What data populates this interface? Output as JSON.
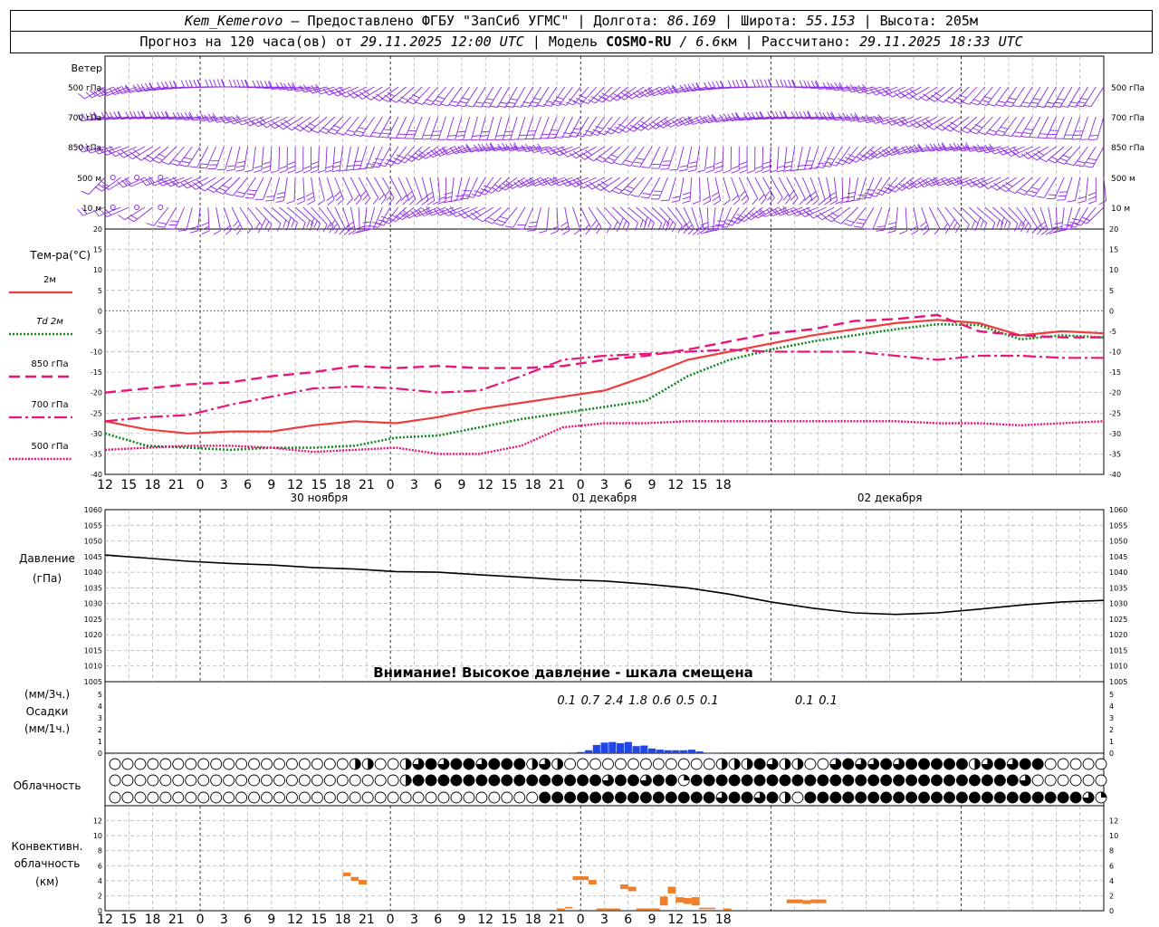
{
  "header": {
    "station": "Kem_Kemerovo",
    "provider": "— Предоставлено ФГБУ \"ЗапСиб УГМС\"",
    "lon_label": "Долгота:",
    "lon": "86.169",
    "lat_label": "Широта:",
    "lat": "55.153",
    "alt_label": "Высота:",
    "alt": "205",
    "alt_unit": "м",
    "forecast_label": "Прогноз на 120 часа(ов) от",
    "run": "29.11.2025 12:00 UTC",
    "model_label": "Модель",
    "model": "COSMO-RU",
    "res": "/ 6.6",
    "res_unit": "км",
    "calc_label": "Рассчитано:",
    "calc": "29.11.2025 18:33 UTC",
    "sep": "|"
  },
  "colors": {
    "t2m": "#f03c3c",
    "td2m": "#11881f",
    "t850": "#e8157a",
    "t700": "#e8157a",
    "t500": "#e8157a",
    "wind": "#8a2be2",
    "pressure": "#000000",
    "precip": "#2046e8",
    "conv": "#f07f2a",
    "zero": "#3355dd"
  },
  "chart_data": [
    {
      "type": "wind-barbs",
      "title": "Ветер",
      "levels": [
        "500 гПа",
        "700 гПа",
        "850 гПа",
        "500 м",
        "10 м"
      ],
      "time_step_h": 1
    },
    {
      "type": "line",
      "ylabel": "Тем-ра(°С)",
      "ylim": [
        -40,
        20
      ],
      "yticks": [
        20,
        15,
        10,
        5,
        0,
        -5,
        -10,
        -15,
        -20,
        -25,
        -30,
        -35,
        -40
      ],
      "x_hours": [
        0,
        6,
        12,
        18,
        24,
        30,
        36,
        42,
        48,
        54,
        60,
        66,
        72,
        78,
        84,
        90,
        96,
        102,
        108,
        114,
        120,
        126
      ],
      "series": [
        {
          "name": "2м",
          "style": "solid",
          "values": [
            -27,
            -29,
            -30,
            -29.5,
            -29.5,
            -28,
            -27,
            -27.5,
            -26,
            -24,
            -22.5,
            -21,
            -19.5,
            -16,
            -12,
            -10,
            -8,
            -6,
            -4.5,
            -3,
            -2.2,
            -3,
            -6,
            -5,
            -5.5
          ]
        },
        {
          "name": "Td 2м",
          "style": "dotted",
          "values": [
            -30,
            -33,
            -33.5,
            -34,
            -33.5,
            -33.5,
            -33,
            -31,
            -30.5,
            -28.5,
            -26.5,
            -25,
            -23.5,
            -22,
            -16,
            -12,
            -9.5,
            -7.5,
            -6,
            -4.5,
            -3.3,
            -3.5,
            -7,
            -6,
            -6.5
          ]
        },
        {
          "name": "850 гПа",
          "style": "dash",
          "values": [
            -20,
            -19,
            -18,
            -17.5,
            -16,
            -15,
            -13.5,
            -14,
            -13.5,
            -14,
            -14,
            -13.5,
            -12,
            -11,
            -9.5,
            -7.5,
            -5.5,
            -4.5,
            -2.5,
            -2,
            -1,
            -5,
            -6,
            -6.5,
            -6.5
          ]
        },
        {
          "name": "700 гПа",
          "style": "dashdot",
          "values": [
            -27,
            -26,
            -25.5,
            -23,
            -21,
            -19,
            -18.5,
            -19,
            -20,
            -19.5,
            -16,
            -12,
            -11,
            -10.5,
            -10,
            -9.5,
            -10,
            -10,
            -10,
            -11,
            -12,
            -11,
            -11,
            -11.5,
            -11.5
          ]
        },
        {
          "name": "500 гПа",
          "style": "dotted",
          "values": [
            -34,
            -33.5,
            -33,
            -33,
            -33.5,
            -34.5,
            -34,
            -33.5,
            -35,
            -35,
            -33,
            -28.5,
            -27.5,
            -27.5,
            -27,
            -27,
            -27,
            -27,
            -27,
            -27,
            -27.5,
            -27.5,
            -28,
            -27.5,
            -27
          ]
        }
      ],
      "x_ticks": [
        "12",
        "15",
        "18",
        "21",
        "0",
        "3",
        "6",
        "9",
        "12",
        "15",
        "18",
        "21",
        "0",
        "3",
        "6",
        "9",
        "12",
        "15",
        "18",
        "21",
        "0",
        "3",
        "6",
        "9",
        "12",
        "15",
        "18"
      ],
      "dates": [
        "30 ноября",
        "01 декабря",
        "02 декабря"
      ]
    },
    {
      "type": "line",
      "ylabel": "Давление",
      "yunit": "(гПа)",
      "ylim": [
        1005,
        1060
      ],
      "yticks": [
        1060,
        1055,
        1050,
        1045,
        1040,
        1035,
        1030,
        1025,
        1020,
        1015,
        1010,
        1005
      ],
      "values": [
        1045.5,
        1044.5,
        1043.5,
        1042.8,
        1042.3,
        1041.5,
        1041,
        1040.2,
        1040,
        1039.2,
        1038.4,
        1037.6,
        1037.2,
        1036.2,
        1035,
        1033,
        1030.5,
        1028.5,
        1027,
        1026.5,
        1027,
        1028.2,
        1029.5,
        1030.5,
        1031
      ],
      "annotation": "Внимание! Высокое давление - шкала смещена"
    },
    {
      "type": "bar",
      "ylabel_top": "(мм/3ч.)",
      "ylabel": "Осадки",
      "yunit": "(мм/1ч.)",
      "ylim": [
        0,
        5
      ],
      "yticks": [
        5,
        4,
        3,
        2,
        1,
        0
      ],
      "bars": [
        {
          "h": 57,
          "v": 0.05
        },
        {
          "h": 58,
          "v": 0.05
        },
        {
          "h": 60,
          "v": 0.1
        },
        {
          "h": 61,
          "v": 0.25
        },
        {
          "h": 62,
          "v": 0.7
        },
        {
          "h": 63,
          "v": 0.9
        },
        {
          "h": 64,
          "v": 0.95
        },
        {
          "h": 65,
          "v": 0.85
        },
        {
          "h": 66,
          "v": 0.95
        },
        {
          "h": 67,
          "v": 0.6
        },
        {
          "h": 68,
          "v": 0.65
        },
        {
          "h": 69,
          "v": 0.4
        },
        {
          "h": 70,
          "v": 0.3
        },
        {
          "h": 71,
          "v": 0.25
        },
        {
          "h": 72,
          "v": 0.25
        },
        {
          "h": 73,
          "v": 0.25
        },
        {
          "h": 74,
          "v": 0.3
        },
        {
          "h": 75,
          "v": 0.15
        },
        {
          "h": 76,
          "v": 0.05
        },
        {
          "h": 77,
          "v": 0.05
        },
        {
          "h": 88,
          "v": 0.05
        },
        {
          "h": 89,
          "v": 0.05
        },
        {
          "h": 92,
          "v": 0.05
        },
        {
          "h": 93,
          "v": 0.05
        }
      ],
      "labels_3h": [
        {
          "h": 58,
          "text": "0.1"
        },
        {
          "h": 61,
          "text": "0.7"
        },
        {
          "h": 64,
          "text": "2.4"
        },
        {
          "h": 67,
          "text": "1.8"
        },
        {
          "h": 70,
          "text": "0.6"
        },
        {
          "h": 73,
          "text": "0.5"
        },
        {
          "h": 76,
          "text": "0.1"
        },
        {
          "h": 88,
          "text": "0.1"
        },
        {
          "h": 91,
          "text": "0.1"
        }
      ]
    },
    {
      "type": "cloud-symbols",
      "ylabel": "Облачность",
      "rows": [
        "0000000000000000000220023434434442320000000000002224322003433434444423434400000000000000000000000004004243200",
        "0000000000000000000000024444444444444443443441444444444444444444444444443000000000000000000000000002314210000",
        "0000000000000000000000000000000000444444444444443443420444444444444444444444431000000000000000000044444444444"
      ]
    },
    {
      "type": "bar",
      "ylabel": "Конвективн.",
      "ylabel2": "облачность",
      "yunit": "(км)",
      "ylim": [
        0,
        14
      ],
      "yticks": [
        12,
        10,
        8,
        6,
        4,
        2,
        0
      ],
      "segments": [
        {
          "h0": 30,
          "h1": 31,
          "base": 4.6,
          "top": 5.1
        },
        {
          "h0": 31,
          "h1": 32,
          "base": 4.0,
          "top": 4.5
        },
        {
          "h0": 32,
          "h1": 33,
          "base": 3.5,
          "top": 4.1
        },
        {
          "h0": 57,
          "h1": 58,
          "base": 0.1,
          "top": 0.3
        },
        {
          "h0": 58,
          "h1": 59,
          "base": 0.3,
          "top": 0.5
        },
        {
          "h0": 59,
          "h1": 60,
          "base": 4.1,
          "top": 4.6
        },
        {
          "h0": 60,
          "h1": 61,
          "base": 4.1,
          "top": 4.6
        },
        {
          "h0": 61,
          "h1": 62,
          "base": 3.5,
          "top": 4.1
        },
        {
          "h0": 62,
          "h1": 65,
          "base": 0.1,
          "top": 0.3
        },
        {
          "h0": 65,
          "h1": 66,
          "base": 2.9,
          "top": 3.5
        },
        {
          "h0": 66,
          "h1": 67,
          "base": 2.6,
          "top": 3.2
        },
        {
          "h0": 67,
          "h1": 70,
          "base": 0.1,
          "top": 0.3
        },
        {
          "h0": 70,
          "h1": 71,
          "base": 0.7,
          "top": 1.9
        },
        {
          "h0": 71,
          "h1": 72,
          "base": 2.3,
          "top": 3.2
        },
        {
          "h0": 72,
          "h1": 73,
          "base": 1.1,
          "top": 1.8
        },
        {
          "h0": 73,
          "h1": 74,
          "base": 0.9,
          "top": 1.7
        },
        {
          "h0": 74,
          "h1": 75,
          "base": 0.7,
          "top": 1.8
        },
        {
          "h0": 75,
          "h1": 77,
          "base": 0.2,
          "top": 0.4
        },
        {
          "h0": 78,
          "h1": 79,
          "base": 0.1,
          "top": 0.3
        },
        {
          "h0": 86,
          "h1": 88,
          "base": 1.0,
          "top": 1.5
        },
        {
          "h0": 88,
          "h1": 89,
          "base": 0.9,
          "top": 1.4
        },
        {
          "h0": 89,
          "h1": 91,
          "base": 1.0,
          "top": 1.5
        }
      ]
    }
  ]
}
